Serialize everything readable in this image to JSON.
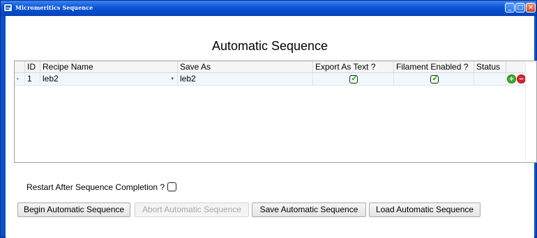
{
  "window": {
    "title": "Micromeritics Sequence",
    "min": "_",
    "max": "□",
    "close": "×"
  },
  "heading": "Automatic Sequence",
  "grid": {
    "columns": {
      "id": "ID",
      "recipe": "Recipe Name",
      "save_as": "Save As",
      "export": "Export As Text ?",
      "filament": "Filament Enabled ?",
      "status": "Status"
    },
    "rows": [
      {
        "indicator": "▸",
        "id": "1",
        "recipe": "leb2",
        "save_as": "leb2",
        "export": true,
        "filament": true,
        "status": ""
      }
    ],
    "check_glyph": "✓",
    "add_glyph": "+",
    "remove_glyph": "−",
    "combo_arrow": "▾"
  },
  "restart": {
    "label": "Restart After Sequence Completion ?",
    "checked": false
  },
  "buttons": {
    "begin": "Begin Automatic Sequence",
    "abort": "Abort Automatic Sequence",
    "save": "Save Automatic Sequence",
    "load": "Load Automatic Sequence"
  },
  "colors": {
    "accent": "#0a54d6",
    "add": "#3aaa2c",
    "remove": "#d8262b",
    "check": "#2d9a18"
  }
}
